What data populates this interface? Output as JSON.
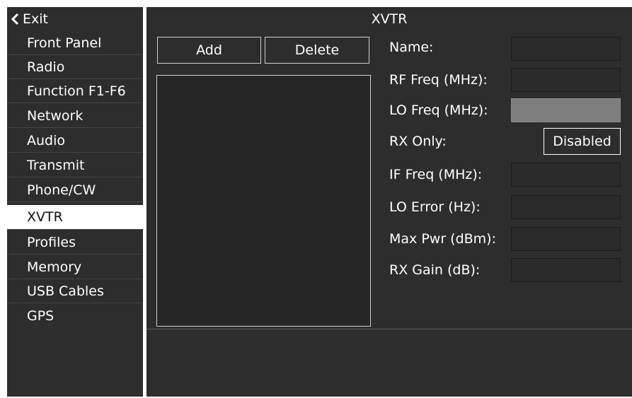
{
  "sidebar": {
    "exit_label": "Exit",
    "items": [
      {
        "label": "Front Panel"
      },
      {
        "label": "Radio"
      },
      {
        "label": "Function F1-F6"
      },
      {
        "label": "Network"
      },
      {
        "label": "Audio"
      },
      {
        "label": "Transmit"
      },
      {
        "label": "Phone/CW"
      },
      {
        "label": "XVTR"
      },
      {
        "label": "Profiles"
      },
      {
        "label": "Memory"
      },
      {
        "label": "USB Cables"
      },
      {
        "label": "GPS"
      }
    ],
    "active_item": "XVTR"
  },
  "panel": {
    "title": "XVTR",
    "add_label": "Add",
    "delete_label": "Delete",
    "fields": {
      "name": {
        "label": "Name:",
        "value": ""
      },
      "rf_freq": {
        "label": "RF Freq (MHz):",
        "value": ""
      },
      "lo_freq": {
        "label": "LO Freq (MHz):",
        "value": ""
      },
      "rx_only": {
        "label": "RX Only:",
        "value": "Disabled"
      },
      "if_freq": {
        "label": "IF Freq (MHz):",
        "value": ""
      },
      "lo_error": {
        "label": "LO Error (Hz):",
        "value": ""
      },
      "max_pwr": {
        "label": "Max Pwr (dBm):",
        "value": ""
      },
      "rx_gain": {
        "label": "RX Gain (dB):",
        "value": ""
      }
    }
  },
  "icons": {
    "exit": "chevron-left-icon"
  },
  "colors": {
    "background": "#2d2d2d",
    "active_item_bg": "#ffffff",
    "text": "#ffffff",
    "lo_field_bg": "#7d7d7d"
  }
}
